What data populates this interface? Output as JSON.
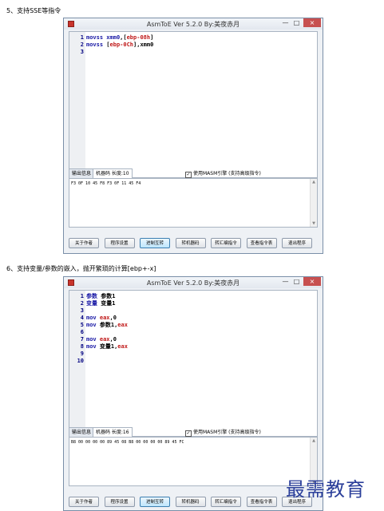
{
  "captions": [
    "5、支持SSE等指令",
    "6、支持变量/参数的嵌入，抛开繁琐的计算[ebp+-x]"
  ],
  "window_title": "AsmToE Ver 5.2.0  By:美夜赤月",
  "window_buttons": {
    "minimize": "—",
    "maximize": "□",
    "close": "×"
  },
  "tabs": [
    "输出信息",
    "机器码 长度:10",
    "机器码 长度:16"
  ],
  "checkbox_label": "使用MASM引擎 (支持高级指令)",
  "checkbox_mark": "✓",
  "scroll": {
    "up": "▲",
    "down": "▼"
  },
  "window1": {
    "lines": [
      {
        "n": "1",
        "parts": [
          [
            "k",
            "movss "
          ],
          [
            "k",
            "xmm0"
          ],
          [
            "t",
            ",["
          ],
          [
            "r",
            "ebp-08h"
          ],
          [
            "t",
            "]"
          ]
        ]
      },
      {
        "n": "2",
        "parts": [
          [
            "k",
            "movss "
          ],
          [
            "t",
            "["
          ],
          [
            "r",
            "ebp-0Ch"
          ],
          [
            "t",
            "],xmm0"
          ]
        ]
      },
      {
        "n": "3",
        "parts": []
      }
    ],
    "output": "F3 0F 10 45 F8 F3 0F 11 45 F4"
  },
  "window2": {
    "lines": [
      {
        "n": "1",
        "parts": [
          [
            "k",
            "参数 "
          ],
          [
            "t",
            "参数1"
          ]
        ]
      },
      {
        "n": "2",
        "parts": [
          [
            "k",
            "变量 "
          ],
          [
            "t",
            "变量1"
          ]
        ]
      },
      {
        "n": "3",
        "parts": []
      },
      {
        "n": "4",
        "parts": [
          [
            "k",
            "mov "
          ],
          [
            "r",
            "eax"
          ],
          [
            "t",
            ",0"
          ]
        ]
      },
      {
        "n": "5",
        "parts": [
          [
            "k",
            "mov "
          ],
          [
            "t",
            "参数1,"
          ],
          [
            "r",
            "eax"
          ]
        ]
      },
      {
        "n": "6",
        "parts": []
      },
      {
        "n": "7",
        "parts": [
          [
            "k",
            "mov "
          ],
          [
            "r",
            "eax"
          ],
          [
            "t",
            ",0"
          ]
        ]
      },
      {
        "n": "8",
        "parts": [
          [
            "k",
            "mov "
          ],
          [
            "t",
            "变量1,"
          ],
          [
            "r",
            "eax"
          ]
        ]
      },
      {
        "n": "9",
        "parts": []
      },
      {
        "n": "10",
        "parts": []
      }
    ],
    "output": "B8 00 00 00 00 89 45 08 B8 00 00 00 00 89 45 FC"
  },
  "buttons": [
    "关于作者",
    "程序设置",
    "进制互转",
    "转机器码",
    "转汇编指令",
    "查看指令表",
    "退出程序"
  ],
  "watermark": "最需教育",
  "colors": {
    "keyword": "#1a1aa6",
    "register": "#c01818",
    "close": "#c75050"
  }
}
